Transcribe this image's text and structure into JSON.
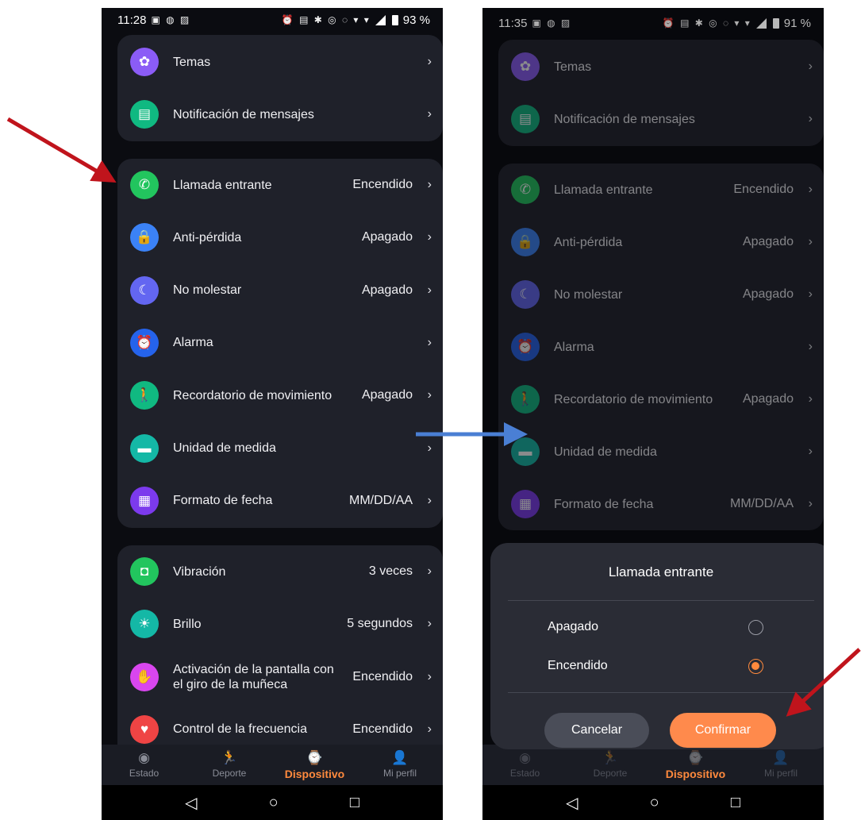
{
  "phone_left": {
    "status": {
      "time": "11:28",
      "battery": "93 %"
    },
    "card1": [
      {
        "icon": "theme-icon",
        "glyph": "✿",
        "color": "#8b5cf6",
        "label": "Temas",
        "value": ""
      },
      {
        "icon": "message-icon",
        "glyph": "▤",
        "color": "#10b981",
        "label": "Notificación de mensajes",
        "value": ""
      }
    ],
    "card2": [
      {
        "icon": "phone-icon",
        "glyph": "✆",
        "color": "#22c55e",
        "label": "Llamada entrante",
        "value": "Encendido"
      },
      {
        "icon": "lock-icon",
        "glyph": "🔒",
        "color": "#3b82f6",
        "label": "Anti-pérdida",
        "value": "Apagado"
      },
      {
        "icon": "moon-icon",
        "glyph": "☾",
        "color": "#6366f1",
        "label": "No molestar",
        "value": "Apagado"
      },
      {
        "icon": "alarm-icon",
        "glyph": "⏰",
        "color": "#2563eb",
        "label": "Alarma",
        "value": ""
      },
      {
        "icon": "walk-icon",
        "glyph": "🚶",
        "color": "#10b981",
        "label": "Recordatorio de movimiento",
        "value": "Apagado"
      },
      {
        "icon": "ruler-icon",
        "glyph": "▬",
        "color": "#14b8a6",
        "label": "Unidad de medida",
        "value": ""
      },
      {
        "icon": "calendar-icon",
        "glyph": "▦",
        "color": "#7c3aed",
        "label": "Formato de fecha",
        "value": "MM/DD/AA"
      }
    ],
    "card3": [
      {
        "icon": "vibration-icon",
        "glyph": "◘",
        "color": "#22c55e",
        "label": "Vibración",
        "value": "3 veces"
      },
      {
        "icon": "brightness-icon",
        "glyph": "☀",
        "color": "#14b8a6",
        "label": "Brillo",
        "value": "5 segundos"
      },
      {
        "icon": "wrist-icon",
        "glyph": "✋",
        "color": "#d946ef",
        "label": "Activación de la pantalla con el giro de la muñeca",
        "value": "Encendido"
      },
      {
        "icon": "heart-icon",
        "glyph": "♥",
        "color": "#ef4444",
        "label": "Control de la frecuencia",
        "value": "Encendido"
      }
    ]
  },
  "phone_right": {
    "status": {
      "time": "11:35",
      "battery": "91 %"
    },
    "dialog": {
      "title": "Llamada entrante",
      "options": [
        "Apagado",
        "Encendido"
      ],
      "selected": 1,
      "cancel": "Cancelar",
      "confirm": "Confirmar"
    }
  },
  "nav": [
    {
      "icon": "status-icon",
      "glyph": "◉",
      "label": "Estado"
    },
    {
      "icon": "sport-icon",
      "glyph": "🏃",
      "label": "Deporte"
    },
    {
      "icon": "watch-icon",
      "glyph": "⌚",
      "label": "Dispositivo",
      "active": true
    },
    {
      "icon": "profile-icon",
      "glyph": "👤",
      "label": "Mi perfil"
    }
  ],
  "sysnav": [
    "◁",
    "○",
    "□"
  ],
  "colors": {
    "accent": "#ff8a3d",
    "arrow_red": "#c0141c",
    "arrow_blue": "#4a7fd4"
  }
}
